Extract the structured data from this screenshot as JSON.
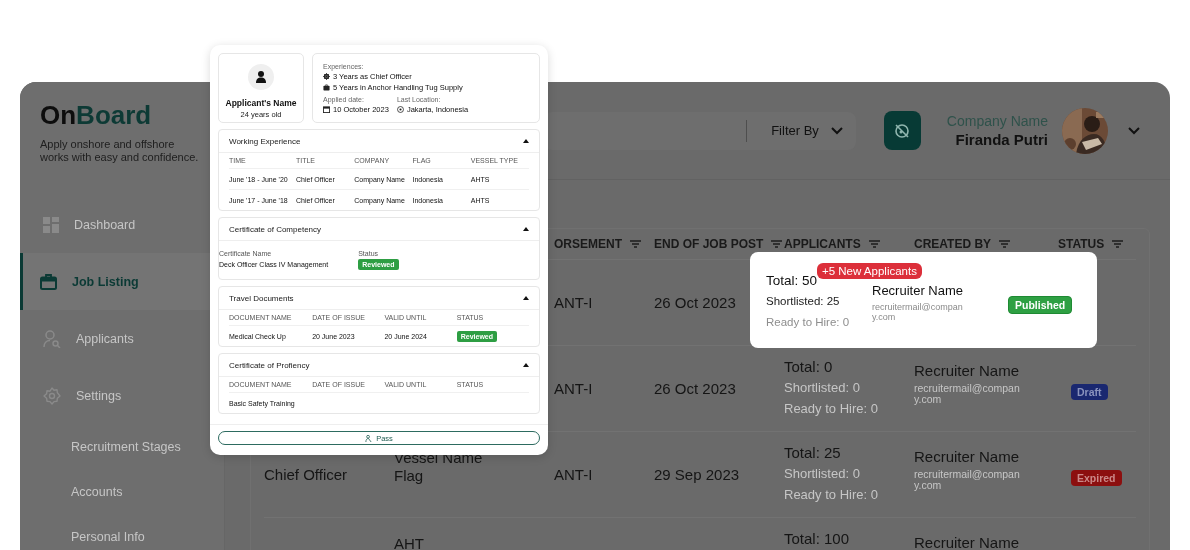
{
  "sidebar": {
    "logo": [
      "On",
      "Board"
    ],
    "tagline": "Apply onshore and offshore works with easy and confidence.",
    "items": [
      {
        "label": "Dashboard",
        "selected": false
      },
      {
        "label": "Job Listing",
        "selected": true
      },
      {
        "label": "Applicants",
        "selected": false
      },
      {
        "label": "Settings",
        "selected": false,
        "children": [
          {
            "label": "Recruitment Stages",
            "selected": false
          },
          {
            "label": "Accounts",
            "selected": false
          },
          {
            "label": "Personal Info",
            "selected": false
          }
        ]
      }
    ]
  },
  "header": {
    "filter": "Filter By",
    "company_label": "Company Name",
    "user_name": "Firanda Putri"
  },
  "table": {
    "columns": [
      "ORSEMENT",
      "END OF JOB POST",
      "APPLICANTS",
      "CREATED BY",
      "STATUS"
    ],
    "rows": [
      {
        "endorsement": "ANT-I",
        "end_date": "26 Oct 2023"
      },
      {
        "endorsement": "ANT-I",
        "end_date": "26 Oct 2023",
        "applicants": {
          "total": "Total: 0",
          "shortlisted": "Shortlisted: 0",
          "ready": "Ready to Hire: 0"
        },
        "recruiter": {
          "name": "Recruiter Name",
          "email": "recruitermail@company.com"
        },
        "status": {
          "label": "Draft",
          "kind": "draft"
        }
      },
      {
        "position": "Chief Officer",
        "vessel": [
          "Vessel Name",
          "Flag"
        ],
        "endorsement": "ANT-I",
        "end_date": "29 Sep 2023",
        "applicants": {
          "total": "Total: 25",
          "shortlisted": "Shortlisted: 0",
          "ready": "Ready to Hire: 0"
        },
        "recruiter": {
          "name": "Recruiter Name",
          "email": "recruitermail@company.com"
        },
        "status": {
          "label": "Expired",
          "kind": "expired"
        }
      },
      {
        "vessel": [
          "AHT"
        ],
        "applicants": {
          "total": "Total: 100"
        },
        "recruiter": {
          "name": "Recruiter Name"
        }
      }
    ]
  },
  "highlight_row": {
    "new_badge": "+5 New Applicants",
    "applicants": {
      "total": "Total: 50",
      "shortlisted": "Shortlisted: 25",
      "ready": "Ready to Hire: 0"
    },
    "recruiter": {
      "name": "Recruiter Name",
      "email": "recruitermail@company.com"
    },
    "status": {
      "label": "Published",
      "kind": "published"
    }
  },
  "applicant_card": {
    "name": "Applicant's Name",
    "age": "24 years old",
    "experiences_label": "Experiences:",
    "experiences": [
      "3 Years as Chief Officer",
      "5 Years in Anchor Handling Tug Supply"
    ],
    "applied_label": "Applied date:",
    "applied_date": "10 October 2023",
    "location_label": "Last Location:",
    "location": "Jakarta, Indonesia",
    "sections": [
      {
        "kind": "table",
        "title": "Working Experience",
        "expanded": true,
        "columns": [
          {
            "label": "TIME",
            "kind": "text"
          },
          {
            "label": "TITLE",
            "kind": "text"
          },
          {
            "label": "COMPANY",
            "kind": "text"
          },
          {
            "label": "FLAG",
            "kind": "text"
          },
          {
            "label": "VESSEL TYPE",
            "kind": "text"
          }
        ],
        "rows": [
          [
            "June '18 - June '20",
            "Chief Officer",
            "Company Name",
            "Indonesia",
            "AHTS"
          ],
          [
            "June '17 - June '18",
            "Chief Officer",
            "Company Name",
            "Indonesia",
            "AHTS"
          ]
        ]
      },
      {
        "kind": "fields",
        "title": "Certificate of Competency",
        "expanded": true,
        "fields": [
          {
            "label": "Certificate Name",
            "value": "Deck Officer Class IV Management",
            "kind": "text"
          },
          {
            "label": "Status",
            "value": "Reviewed",
            "kind": "badge"
          }
        ]
      },
      {
        "kind": "table",
        "title": "Travel Documents",
        "expanded": true,
        "columns": [
          {
            "label": "DOCUMENT NAME",
            "kind": "text"
          },
          {
            "label": "DATE OF ISSUE",
            "kind": "text"
          },
          {
            "label": "VALID UNTIL",
            "kind": "text"
          },
          {
            "label": "STATUS",
            "kind": "badge"
          }
        ],
        "rows": [
          [
            "Medical Check Up",
            "20 June 2023",
            "20 June 2024",
            "Reviewed"
          ]
        ]
      },
      {
        "kind": "table",
        "title": "Certificate of Profiency",
        "expanded": true,
        "columns": [
          {
            "label": "DOCUMENT NAME"
          },
          {
            "label": "DATE OF ISSUE"
          },
          {
            "label": "VALID UNTIL"
          },
          {
            "label": "STATUS"
          }
        ],
        "rows": [
          [
            "Basic Safety Training"
          ]
        ]
      }
    ],
    "action": "Pass"
  }
}
